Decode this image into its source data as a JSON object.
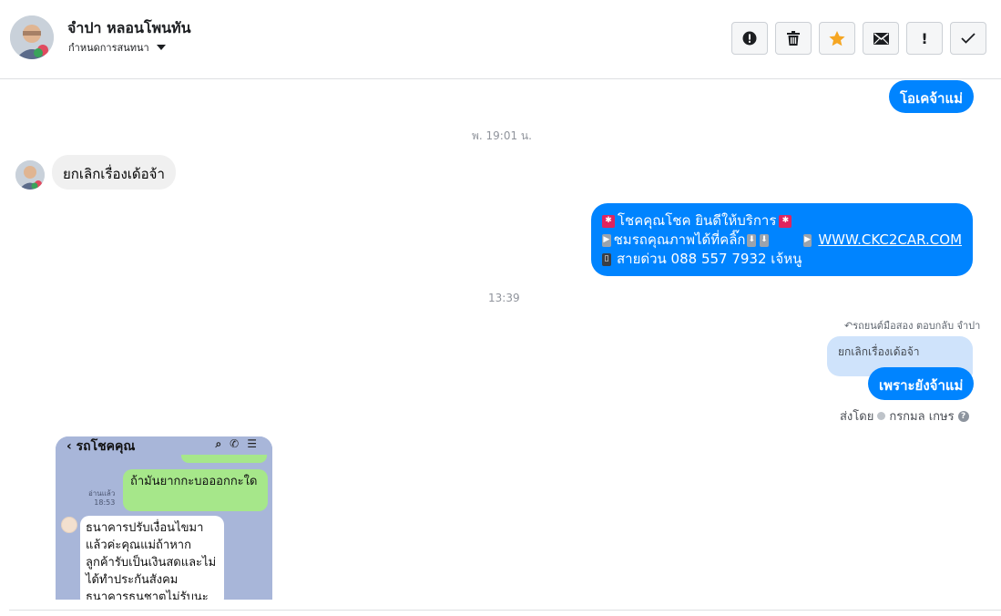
{
  "header": {
    "contact_name": "จำปา หลอนโพนทัน",
    "conversation_label": "กำหนดการสนทนา",
    "actions": [
      {
        "name": "report",
        "icon": "alert-circle-icon"
      },
      {
        "name": "delete",
        "icon": "trash-icon"
      },
      {
        "name": "star",
        "icon": "star-icon",
        "color": "#f5a623"
      },
      {
        "name": "mark-unread",
        "icon": "envelope-icon"
      },
      {
        "name": "important",
        "icon": "exclamation-icon",
        "label": "!"
      },
      {
        "name": "done",
        "icon": "check-icon"
      }
    ]
  },
  "messages": {
    "ok_reply": "โอเคจ้าแม่",
    "timestamp_1": "พ. 19:01 น.",
    "incoming_text": "ยกเลิกเรื่องเด้อจ้า",
    "promo": {
      "line1": "โชคคุณโชค ยินดีให้บริการ",
      "line2_prefix": "ชมรถคุณภาพได้ที่คลิ๊ก",
      "link": "WWW.CKC2CAR.COM",
      "line3": "สายด่วน 088 557 7932 เจ้หนู"
    },
    "timestamp_2": "13:39",
    "reply_meta": "รถยนต์มือสอง ตอบกลับ จำปา",
    "quoted_text": "ยกเลิกเรื่องเด้อจ้า",
    "reply_text": "เพราะยังจ้าแม่",
    "sent_by_label": "ส่งโดย",
    "sent_by_name": "กรกมล เกษร"
  },
  "screenshot_attachment": {
    "title": "รถโชคคุณ",
    "green_message": "ถ้ามันยากกะบอออกกะใด",
    "read_label": "อ่านแล้ว",
    "read_time": "18:53",
    "white_message": "ธนาคารปรับเงื่อนไขมาแล้วค่ะคุณแม่ถ้าหากลูกค้ารับเป็นเงินสดและไม่ได้ทำประกันสังคมธนาคารธนชาตไม่รับนะ"
  },
  "colors": {
    "outgoing_bubble": "#0084ff",
    "incoming_bubble": "#f0f0f0",
    "quoted_bubble": "#cfe3fb",
    "star": "#f5a623"
  }
}
